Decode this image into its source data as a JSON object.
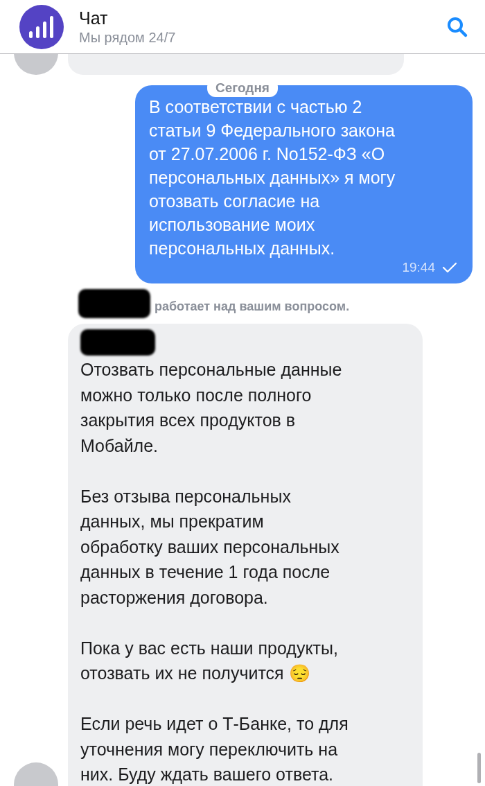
{
  "header": {
    "title": "Чат",
    "subtitle": "Мы рядом 24/7"
  },
  "date_divider": "Сегодня",
  "outgoing": {
    "lines": [
      "В соответствии с частью 2",
      "статьи 9 Федерального закона",
      "от 27.07.2006 г. No152-ФЗ «О",
      "персональных данных» я могу",
      "отозвать согласие на",
      "использование моих",
      "персональных данных."
    ],
    "time": "19:44",
    "delivered": true
  },
  "status": "работает над вашим вопросом.",
  "incoming": {
    "paragraphs": [
      {
        "lines": [
          "Отозвать персональные данные",
          "можно только после полного",
          "закрытия всех продуктов в",
          "Мобайле."
        ]
      },
      {
        "lines": [
          "Без отзыва персональных",
          "данных, мы прекратим",
          "обработку ваших персональных",
          "данных в течение 1 года после",
          "расторжения договора."
        ]
      },
      {
        "lines": [
          "Пока у вас есть наши продукты,",
          "отозвать их не получится 😔"
        ]
      },
      {
        "lines": [
          "Если речь идет о Т-Банке, то для",
          "уточнения могу переключить на",
          "них. Буду ждать вашего ответа."
        ]
      }
    ]
  }
}
